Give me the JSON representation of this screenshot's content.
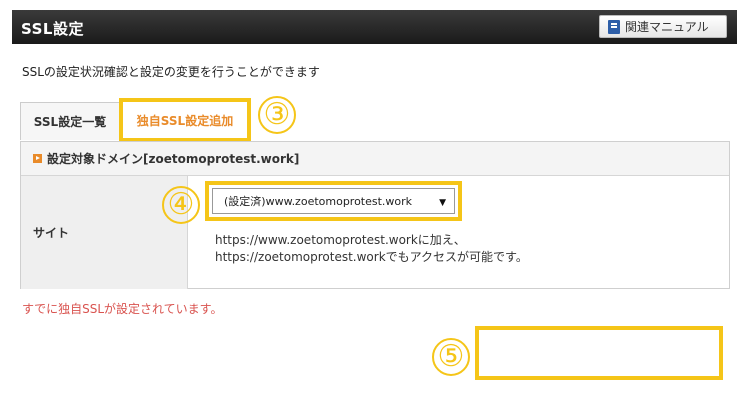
{
  "header": {
    "title": "SSL設定",
    "manual_button": "関連マニュアル"
  },
  "description": "SSLの設定状況確認と設定の変更を行うことができます",
  "tabs": [
    {
      "label": "SSL設定一覧"
    },
    {
      "label": "独自SSL設定追加"
    }
  ],
  "steps": {
    "three": "③",
    "four": "④",
    "five": "⑤"
  },
  "panel": {
    "title": "設定対象ドメイン[zoetomoprotest.work]",
    "row_label": "サイト",
    "select_value": "(設定済)www.zoetomoprotest.work",
    "info_line1": "https://www.zoetomoprotest.workに加え、",
    "info_line2": "https://zoetomoprotest.workでもアクセスが可能です。"
  },
  "notice": "すでに独自SSLが設定されています。",
  "colors": {
    "highlight": "#f5c518",
    "accent": "#e98b2a",
    "notice": "#d9534f"
  }
}
